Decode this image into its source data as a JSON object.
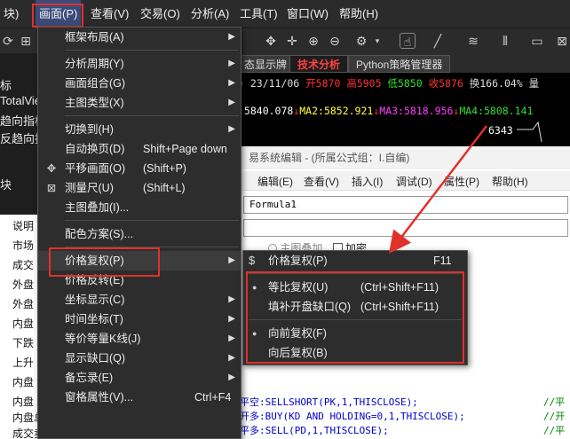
{
  "menubar": {
    "items": [
      "块)",
      "画面(P)",
      "查看(V)",
      "交易(O)",
      "分析(A)",
      "工具(T)",
      "窗口(W)",
      "帮助(H)"
    ],
    "active_index": 1,
    "bg": "#2b2b2b"
  },
  "left_pane": {
    "lines": [
      "标",
      "TotalVie",
      "趋向指标",
      "反趋向指"
    ],
    "section_label": "块",
    "header": "说明",
    "list": [
      "市场",
      "成交",
      "外盘",
      "外盘",
      "内盘",
      "下跌",
      "上升",
      "内盘",
      "内盘",
      "内盘总量",
      "成交卖单数"
    ]
  },
  "chart_tabs": [
    "态显示牌",
    "技术分析",
    "Python策略管理器"
  ],
  "quote": {
    "date_line": ") 23/11/06",
    "open": "开5870",
    "high": "高5905",
    "low": "低5850",
    "close": "收5876",
    "turnover": "换166.04%",
    "tail": "量",
    "ma_line_prefix": ":5840.078",
    "ma2": "MA2:5852.921",
    "ma3": "MA3:5818.956",
    "ma4": "MA4:5808.141",
    "price_label": "6343"
  },
  "editor": {
    "title": "易系统编辑 - (所属公式组：I.自编)",
    "menu": [
      "编辑(E)",
      "查看(V)",
      "插入(I)",
      "调试(D)",
      "属性(P)",
      "帮助(H)"
    ],
    "name_value": "Formula1",
    "option1": "主图叠加",
    "option2": "加密",
    "code_lines": [
      {
        "code": "平空:SELLSHORT(PK,1,THISCLOSE);",
        "comment": "//平"
      },
      {
        "code": "开多:BUY(KD AND HOLDING=0,1,THISCLOSE);",
        "comment": "//开"
      },
      {
        "code": "平多:SELL(PD,1,THISCLOSE);",
        "comment": "//平"
      }
    ]
  },
  "main_menu": {
    "items": [
      {
        "label": "框架布局(A)",
        "shortcut": "",
        "submenu": true,
        "icon": ""
      },
      {
        "label": "分析周期(Y)",
        "shortcut": "",
        "submenu": true,
        "icon": ""
      },
      {
        "label": "画面组合(G)",
        "shortcut": "",
        "submenu": true,
        "icon": ""
      },
      {
        "label": "主图类型(X)",
        "shortcut": "",
        "submenu": true,
        "icon": ""
      },
      {
        "label": "切换到(H)",
        "shortcut": "",
        "submenu": true,
        "icon": ""
      },
      {
        "label": "自动换页(D)",
        "shortcut": "Shift+Page down",
        "submenu": false,
        "icon": ""
      },
      {
        "label": "平移画面(O)",
        "shortcut": "(Shift+P)",
        "submenu": false,
        "icon": "move-icon"
      },
      {
        "label": "测量尺(U)",
        "shortcut": "(Shift+L)",
        "submenu": false,
        "icon": "ruler-icon"
      },
      {
        "label": "主图叠加(I)...",
        "shortcut": "",
        "submenu": false,
        "icon": ""
      },
      {
        "label": "配色方案(S)...",
        "shortcut": "",
        "submenu": false,
        "icon": ""
      },
      {
        "label": "价格复权(P)",
        "shortcut": "",
        "submenu": true,
        "icon": ""
      },
      {
        "label": "价格反转(E)",
        "shortcut": "",
        "submenu": false,
        "icon": ""
      },
      {
        "label": "坐标显示(C)",
        "shortcut": "",
        "submenu": true,
        "icon": ""
      },
      {
        "label": "时间坐标(T)",
        "shortcut": "",
        "submenu": true,
        "icon": ""
      },
      {
        "label": "等价等量K线(J)",
        "shortcut": "",
        "submenu": true,
        "icon": ""
      },
      {
        "label": "显示缺口(Q)",
        "shortcut": "",
        "submenu": true,
        "icon": ""
      },
      {
        "label": "备忘录(E)",
        "shortcut": "",
        "submenu": true,
        "icon": ""
      },
      {
        "label": "窗格属性(V)...",
        "shortcut": "Ctrl+F4",
        "submenu": false,
        "icon": ""
      }
    ],
    "highlighted_index": 10
  },
  "submenu": {
    "items": [
      {
        "label": "价格复权(P)",
        "shortcut": "F11",
        "bullet": false,
        "icon": "dollar-icon"
      },
      {
        "label": "等比复权(U)",
        "shortcut": "(Ctrl+Shift+F11)",
        "bullet": true,
        "icon": ""
      },
      {
        "label": "填补开盘缺口(Q)",
        "shortcut": "(Ctrl+Shift+F11)",
        "bullet": false,
        "icon": ""
      },
      {
        "label": "向前复权(F)",
        "shortcut": "",
        "bullet": true,
        "icon": ""
      },
      {
        "label": "向后复权(B)",
        "shortcut": "",
        "bullet": false,
        "icon": ""
      }
    ]
  },
  "colors": {
    "highlight_red": "#e0312b",
    "quote_red": "#ff3030",
    "quote_green": "#30e030",
    "ma_yellow": "#ffff40",
    "ma_magenta": "#ff40ff"
  }
}
